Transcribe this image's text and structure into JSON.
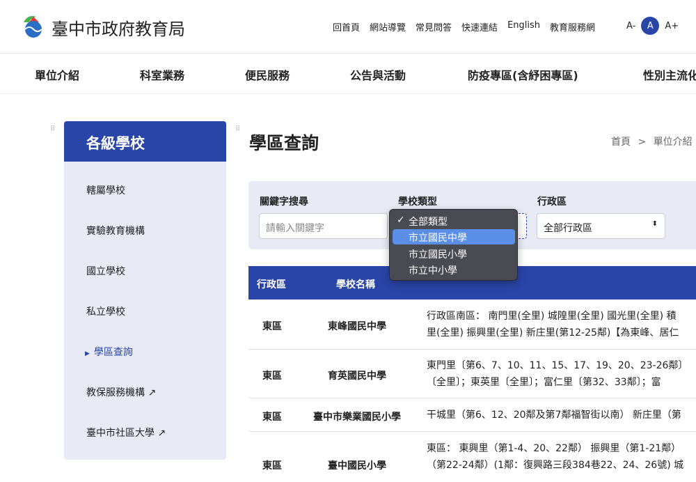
{
  "header": {
    "site_title": "臺中市政府教育局",
    "links": [
      "回首頁",
      "網站導覽",
      "常見問答",
      "快速連結",
      "English",
      "教育服務網"
    ],
    "font_small": "A-",
    "font_current": "A",
    "font_large": "A+"
  },
  "nav": [
    "單位介紹",
    "科室業務",
    "便民服務",
    "公告與活動",
    "防疫專區(含紓困專區)",
    "性別主流化"
  ],
  "sidebar": {
    "title": "各級學校",
    "items": [
      "轄屬學校",
      "實驗教育機構",
      "國立學校",
      "私立學校",
      "學區查詢",
      "教保服務機構",
      "臺中市社區大學"
    ],
    "active": "學區查詢"
  },
  "main": {
    "title": "學區查詢",
    "breadcrumb": [
      "首頁",
      "單位介紹"
    ],
    "breadcrumb_sep": ">"
  },
  "filter": {
    "keyword_label": "關鍵字搜尋",
    "keyword_placeholder": "請輸入關鍵字",
    "type_label": "學校類型",
    "district_label": "行政區",
    "district_value": "全部行政區"
  },
  "dropdown": {
    "options": [
      "全部類型",
      "市立國民中學",
      "市立國民小學",
      "市立中小學"
    ],
    "checked": "全部類型",
    "highlighted": "市立國民中學"
  },
  "table": {
    "headers": [
      "行政區",
      "學校名稱"
    ],
    "rows": [
      {
        "district": "東區",
        "school": "東峰國民中學",
        "desc": [
          "行政區南區： 南門里(全里) 城隍里(全里) 國光里(全里) 積",
          "里(全里) 振興里(全里) 新庄里(第12-25鄰)【為東峰、居仁"
        ]
      },
      {
        "district": "東區",
        "school": "育英國民中學",
        "desc": [
          "東門里〔第6、7、10、11、15、17、19、20、23-26鄰〕",
          "〔全里〕；東英里〔全里〕；富仁里〔第32、33鄰〕；富"
        ]
      },
      {
        "district": "東區",
        "school": "臺中市樂業國民小學",
        "desc": [
          "干城里（第6、12、20鄰及第7鄰福智街以南） 新庄里（第"
        ]
      },
      {
        "district": "東區",
        "school": "臺中國民小學",
        "desc": [
          "東區： 東興里（第1-4、20、22鄰） 振興里（第1-21鄰）",
          "（第22-24鄰）(1鄰：復興路三段384巷22、24、26號) 城"
        ]
      }
    ]
  },
  "colors": {
    "brand": "#2a45a8",
    "panel": "#e8ebf5"
  }
}
